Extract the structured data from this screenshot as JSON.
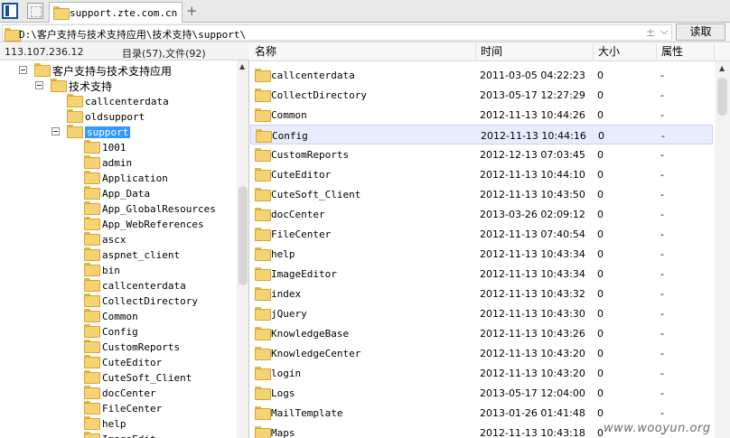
{
  "tab": {
    "title": "support.zte.com.cn"
  },
  "path": {
    "value": "D:\\客户支持与技术支持应用\\技术支持\\support\\",
    "fav_glyph": "±",
    "drop_glyph": "⌵"
  },
  "read_button": "读取",
  "status": {
    "ip": "113.107.236.12",
    "count": "目录(57),文件(92)"
  },
  "tree": [
    {
      "label": "客户支持与技术支持应用",
      "toggle": true,
      "indent": 0
    },
    {
      "label": "技术支持",
      "toggle": true,
      "indent": 1
    },
    {
      "label": "callcenterdata",
      "toggle": false,
      "indent": 2
    },
    {
      "label": "oldsupport",
      "toggle": false,
      "indent": 2
    },
    {
      "label": "support",
      "toggle": true,
      "indent": 2,
      "selected": true
    },
    {
      "label": "1001",
      "toggle": false,
      "indent": 3
    },
    {
      "label": "admin",
      "toggle": false,
      "indent": 3
    },
    {
      "label": "Application",
      "toggle": false,
      "indent": 3
    },
    {
      "label": "App_Data",
      "toggle": false,
      "indent": 3
    },
    {
      "label": "App_GlobalResources",
      "toggle": false,
      "indent": 3
    },
    {
      "label": "App_WebReferences",
      "toggle": false,
      "indent": 3
    },
    {
      "label": "ascx",
      "toggle": false,
      "indent": 3
    },
    {
      "label": "aspnet_client",
      "toggle": false,
      "indent": 3
    },
    {
      "label": "bin",
      "toggle": false,
      "indent": 3
    },
    {
      "label": "callcenterdata",
      "toggle": false,
      "indent": 3
    },
    {
      "label": "CollectDirectory",
      "toggle": false,
      "indent": 3
    },
    {
      "label": "Common",
      "toggle": false,
      "indent": 3
    },
    {
      "label": "Config",
      "toggle": false,
      "indent": 3
    },
    {
      "label": "CustomReports",
      "toggle": false,
      "indent": 3
    },
    {
      "label": "CuteEditor",
      "toggle": false,
      "indent": 3
    },
    {
      "label": "CuteSoft_Client",
      "toggle": false,
      "indent": 3
    },
    {
      "label": "docCenter",
      "toggle": false,
      "indent": 3
    },
    {
      "label": "FileCenter",
      "toggle": false,
      "indent": 3
    },
    {
      "label": "help",
      "toggle": false,
      "indent": 3
    },
    {
      "label": "ImageEdit",
      "toggle": false,
      "indent": 3
    }
  ],
  "columns": {
    "name": "名称",
    "time": "时间",
    "size": "大小",
    "attr": "属性"
  },
  "files": [
    {
      "name": "callcenterdata",
      "time": "2011-03-05 04:22:23",
      "size": "0",
      "attr": "-"
    },
    {
      "name": "CollectDirectory",
      "time": "2013-05-17 12:27:29",
      "size": "0",
      "attr": "-"
    },
    {
      "name": "Common",
      "time": "2012-11-13 10:44:26",
      "size": "0",
      "attr": "-"
    },
    {
      "name": "Config",
      "time": "2012-11-13 10:44:16",
      "size": "0",
      "attr": "-",
      "selected": true
    },
    {
      "name": "CustomReports",
      "time": "2012-12-13 07:03:45",
      "size": "0",
      "attr": "-"
    },
    {
      "name": "CuteEditor",
      "time": "2012-11-13 10:44:10",
      "size": "0",
      "attr": "-"
    },
    {
      "name": "CuteSoft_Client",
      "time": "2012-11-13 10:43:50",
      "size": "0",
      "attr": "-"
    },
    {
      "name": "docCenter",
      "time": "2013-03-26 02:09:12",
      "size": "0",
      "attr": "-"
    },
    {
      "name": "FileCenter",
      "time": "2012-11-13 07:40:54",
      "size": "0",
      "attr": "-"
    },
    {
      "name": "help",
      "time": "2012-11-13 10:43:34",
      "size": "0",
      "attr": "-"
    },
    {
      "name": "ImageEditor",
      "time": "2012-11-13 10:43:34",
      "size": "0",
      "attr": "-"
    },
    {
      "name": "index",
      "time": "2012-11-13 10:43:32",
      "size": "0",
      "attr": "-"
    },
    {
      "name": "jQuery",
      "time": "2012-11-13 10:43:30",
      "size": "0",
      "attr": "-"
    },
    {
      "name": "KnowledgeBase",
      "time": "2012-11-13 10:43:26",
      "size": "0",
      "attr": "-"
    },
    {
      "name": "KnowledgeCenter",
      "time": "2012-11-13 10:43:20",
      "size": "0",
      "attr": "-"
    },
    {
      "name": "login",
      "time": "2012-11-13 10:43:20",
      "size": "0",
      "attr": "-"
    },
    {
      "name": "Logs",
      "time": "2013-05-17 12:04:00",
      "size": "0",
      "attr": "-"
    },
    {
      "name": "MailTemplate",
      "time": "2013-01-26 01:41:48",
      "size": "0",
      "attr": "-"
    },
    {
      "name": "Maps",
      "time": "2012-11-13 10:43:18",
      "size": "0",
      "attr": "-"
    }
  ],
  "watermark": "www.wooyun.org"
}
